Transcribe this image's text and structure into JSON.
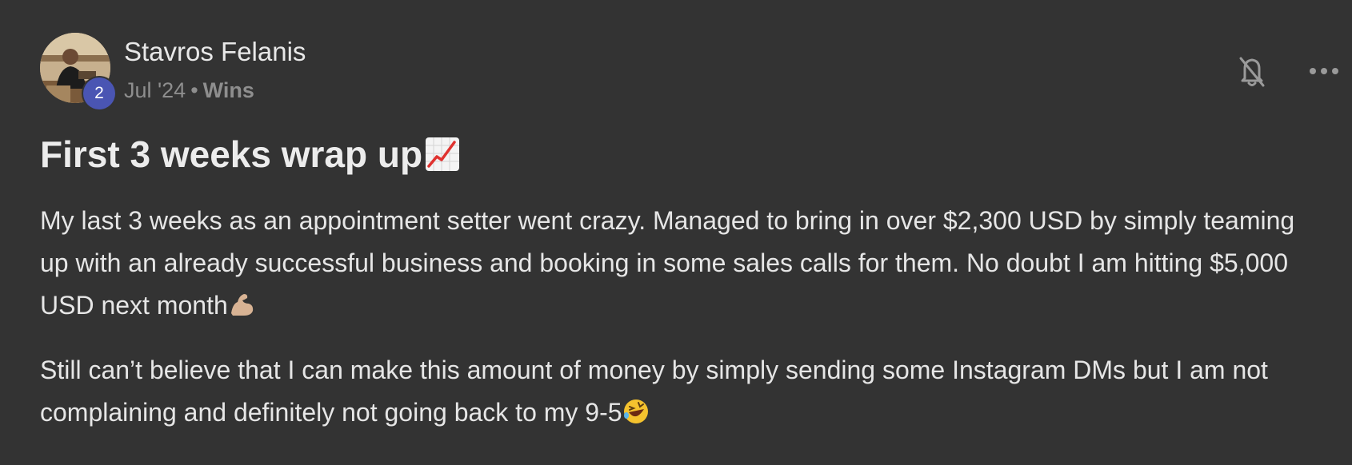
{
  "post": {
    "author": {
      "name": "Stavros Felanis",
      "level": "2"
    },
    "meta": {
      "date": "Jul '24",
      "separator": "•",
      "category": "Wins"
    },
    "title": "First 3 weeks wrap up",
    "paragraphs": [
      "My last 3 weeks as an appointment setter went crazy. Managed to bring in over $2,300 USD by simply teaming up with an already successful business and booking in some sales calls for them. No doubt I am hitting $5,000 USD next month",
      "Still can’t believe that I can make this amount of money by simply sending some Instagram DMs but I am not complaining and definitely not going back to my 9-5"
    ],
    "icons": {
      "title_emoji": "chart-increasing-icon",
      "paragraph_1_emoji": "flexed-biceps-icon",
      "paragraph_2_emoji": "rolling-on-floor-laughing-icon",
      "notification": "bell-off-icon",
      "more": "more-horizontal-icon"
    }
  },
  "colors": {
    "background": "#333333",
    "text": "#e6e6e6",
    "muted": "#8e8e8e",
    "level_badge": "#4a55b3"
  }
}
